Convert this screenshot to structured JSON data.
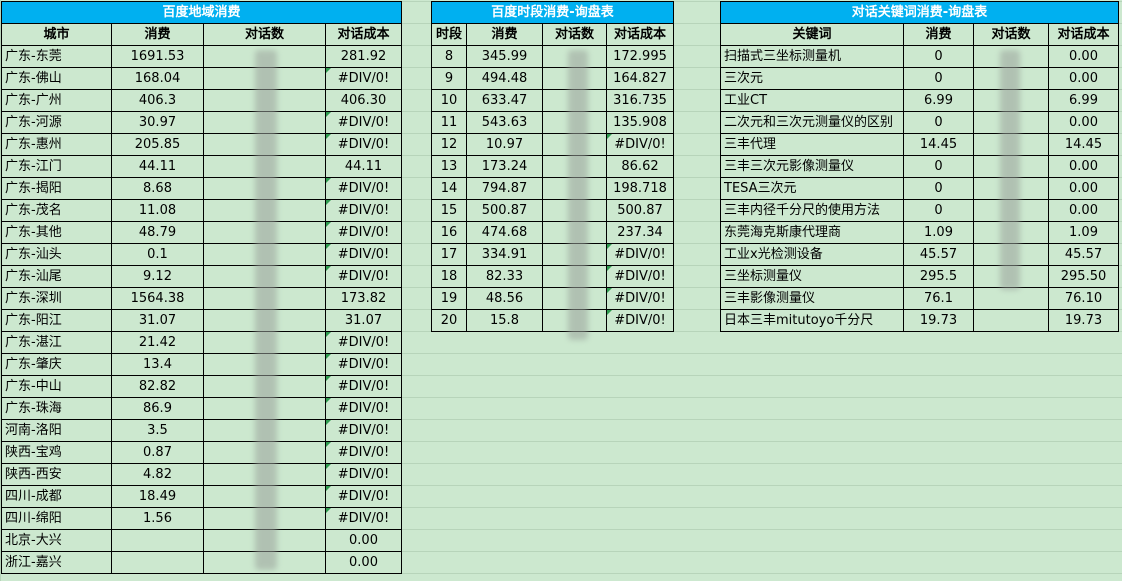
{
  "region": {
    "title": "百度地域消费",
    "headers": [
      "城市",
      "消费",
      "对话数",
      "对话成本"
    ],
    "rows": [
      [
        "广东-东莞",
        "1691.53",
        "",
        "281.92"
      ],
      [
        "广东-佛山",
        "168.04",
        "",
        "#DIV/0!"
      ],
      [
        "广东-广州",
        "406.3",
        "",
        "406.30"
      ],
      [
        "广东-河源",
        "30.97",
        "",
        "#DIV/0!"
      ],
      [
        "广东-惠州",
        "205.85",
        "",
        "#DIV/0!"
      ],
      [
        "广东-江门",
        "44.11",
        "",
        "44.11"
      ],
      [
        "广东-揭阳",
        "8.68",
        "",
        "#DIV/0!"
      ],
      [
        "广东-茂名",
        "11.08",
        "",
        "#DIV/0!"
      ],
      [
        "广东-其他",
        "48.79",
        "",
        "#DIV/0!"
      ],
      [
        "广东-汕头",
        "0.1",
        "",
        "#DIV/0!"
      ],
      [
        "广东-汕尾",
        "9.12",
        "",
        "#DIV/0!"
      ],
      [
        "广东-深圳",
        "1564.38",
        "",
        "173.82"
      ],
      [
        "广东-阳江",
        "31.07",
        "",
        "31.07"
      ],
      [
        "广东-湛江",
        "21.42",
        "",
        "#DIV/0!"
      ],
      [
        "广东-肇庆",
        "13.4",
        "",
        "#DIV/0!"
      ],
      [
        "广东-中山",
        "82.82",
        "",
        "#DIV/0!"
      ],
      [
        "广东-珠海",
        "86.9",
        "",
        "#DIV/0!"
      ],
      [
        "河南-洛阳",
        "3.5",
        "",
        "#DIV/0!"
      ],
      [
        "陕西-宝鸡",
        "0.87",
        "",
        "#DIV/0!"
      ],
      [
        "陕西-西安",
        "4.82",
        "",
        "#DIV/0!"
      ],
      [
        "四川-成都",
        "18.49",
        "",
        "#DIV/0!"
      ],
      [
        "四川-绵阳",
        "1.56",
        "",
        "#DIV/0!"
      ],
      [
        "北京-大兴",
        "",
        "",
        "0.00"
      ],
      [
        "浙江-嘉兴",
        "",
        "",
        "0.00"
      ]
    ]
  },
  "timeslot": {
    "title": "百度时段消费-询盘表",
    "headers": [
      "时段",
      "消费",
      "对话数",
      "对话成本"
    ],
    "rows": [
      [
        "8",
        "345.99",
        "",
        "172.995"
      ],
      [
        "9",
        "494.48",
        "",
        "164.827"
      ],
      [
        "10",
        "633.47",
        "",
        "316.735"
      ],
      [
        "11",
        "543.63",
        "",
        "135.908"
      ],
      [
        "12",
        "10.97",
        "",
        "#DIV/0!"
      ],
      [
        "13",
        "173.24",
        "",
        "86.62"
      ],
      [
        "14",
        "794.87",
        "",
        "198.718"
      ],
      [
        "15",
        "500.87",
        "",
        "500.87"
      ],
      [
        "16",
        "474.68",
        "",
        "237.34"
      ],
      [
        "17",
        "334.91",
        "",
        "#DIV/0!"
      ],
      [
        "18",
        "82.33",
        "",
        "#DIV/0!"
      ],
      [
        "19",
        "48.56",
        "",
        "#DIV/0!"
      ],
      [
        "20",
        "15.8",
        "",
        "#DIV/0!"
      ]
    ]
  },
  "keyword": {
    "title": "对话关键词消费-询盘表",
    "headers": [
      "关键词",
      "消费",
      "对话数",
      "对话成本"
    ],
    "rows": [
      [
        "扫描式三坐标测量机",
        "0",
        "",
        "0.00"
      ],
      [
        "三次元",
        "0",
        "",
        "0.00"
      ],
      [
        "工业CT",
        "6.99",
        "",
        "6.99"
      ],
      [
        "二次元和三次元测量仪的区别",
        "0",
        "",
        "0.00"
      ],
      [
        "三丰代理",
        "14.45",
        "",
        "14.45"
      ],
      [
        "三丰三次元影像测量仪",
        "0",
        "",
        "0.00"
      ],
      [
        "TESA三次元",
        "0",
        "",
        "0.00"
      ],
      [
        "三丰内径千分尺的使用方法",
        "0",
        "",
        "0.00"
      ],
      [
        "东莞海克斯康代理商",
        "1.09",
        "",
        "1.09"
      ],
      [
        "工业x光检测设备",
        "45.57",
        "",
        "45.57"
      ],
      [
        "三坐标测量仪",
        "295.5",
        "",
        "295.50"
      ],
      [
        "三丰影像测量仪",
        "76.1",
        "",
        "76.10"
      ],
      [
        "日本三丰mitutoyo千分尺",
        "19.73",
        "",
        "19.73"
      ]
    ]
  }
}
